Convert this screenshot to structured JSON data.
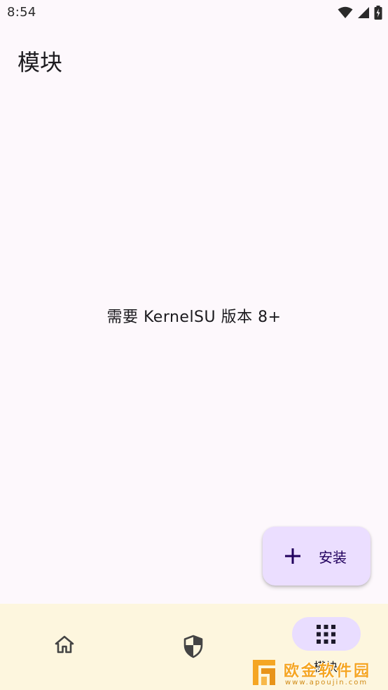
{
  "status_bar": {
    "time": "8:54",
    "icons": [
      "wifi-icon",
      "signal-icon",
      "battery-charging-icon"
    ]
  },
  "page": {
    "title": "模块",
    "empty_message": "需要 KernelSU 版本 8+"
  },
  "fab": {
    "label": "安装",
    "icon": "add-icon"
  },
  "bottom_nav": {
    "items": [
      {
        "id": "home",
        "icon": "home-icon",
        "label": "",
        "selected": false
      },
      {
        "id": "superuser",
        "icon": "shield-icon",
        "label": "",
        "selected": false
      },
      {
        "id": "module",
        "icon": "apps-grid-icon",
        "label": "模块",
        "selected": true
      }
    ]
  },
  "watermark": {
    "text": "欧金软件园",
    "url": "www.apoujin.com"
  },
  "colors": {
    "background": "#fdf8fc",
    "nav_background": "#fdf6de",
    "fab_background": "#ebdeff",
    "selected_pill": "#e9ddff",
    "fab_text": "#21005d",
    "watermark": "#f5a623"
  }
}
